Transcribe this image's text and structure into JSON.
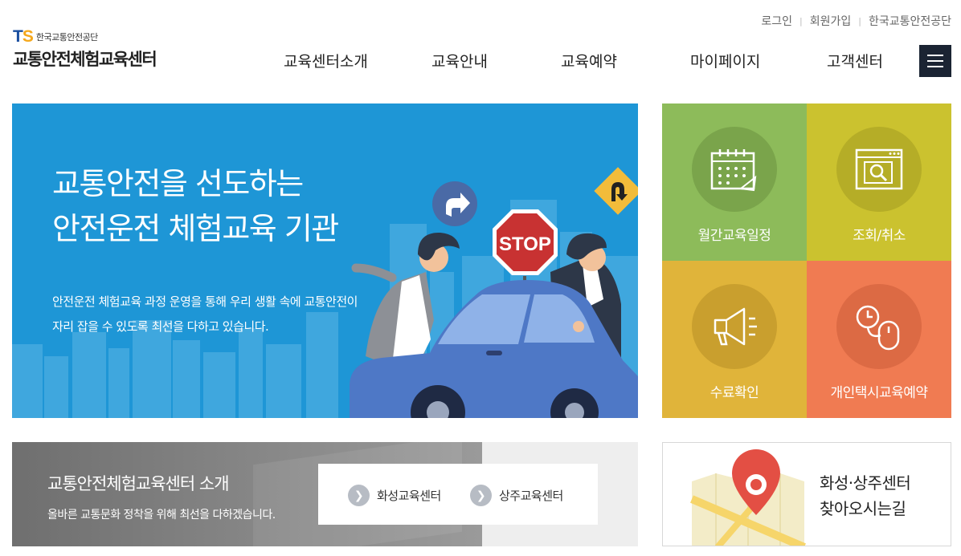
{
  "util_links": [
    "로그인",
    "회원가입",
    "한국교통안전공단"
  ],
  "logo": {
    "mark_t": "T",
    "mark_s": "S",
    "org": "한국교통안전공단",
    "name": "교통안전체험교육센터"
  },
  "nav": [
    "교육센터소개",
    "교육안내",
    "교육예약",
    "마이페이지",
    "고객센터"
  ],
  "hero": {
    "title_line1": "교통안전을 선도하는",
    "title_line2": "안전운전 체험교육 기관",
    "desc_line1": "안전운전 체험교육 과정 운영을 통해 우리 생활 속에 교통안전이",
    "desc_line2": "자리 잡을 수 있도록 최선을 다하고 있습니다.",
    "stop_sign": "STOP"
  },
  "tiles": [
    {
      "label": "월간교육일정",
      "icon": "calendar-icon",
      "color": "#8dbb5a"
    },
    {
      "label": "조회/취소",
      "icon": "search-window-icon",
      "color": "#cbc22f"
    },
    {
      "label": "수료확인",
      "icon": "megaphone-icon",
      "color": "#e0b43a"
    },
    {
      "label": "개인택시교육예약",
      "icon": "mouse-clock-icon",
      "color": "#f07b52"
    }
  ],
  "intro": {
    "title": "교통안전체험교육센터 소개",
    "desc": "올바른 교통문화 정착을 위해 최선을 다하겠습니다.",
    "btn_hwaseong": "화성교육센터",
    "btn_sangju": "상주교육센터"
  },
  "directions": {
    "line1": "화성·상주센터",
    "line2": "찾아오시는길"
  },
  "colors": {
    "hero_bg": "#1e96d6",
    "menu_btn": "#1b2433"
  }
}
